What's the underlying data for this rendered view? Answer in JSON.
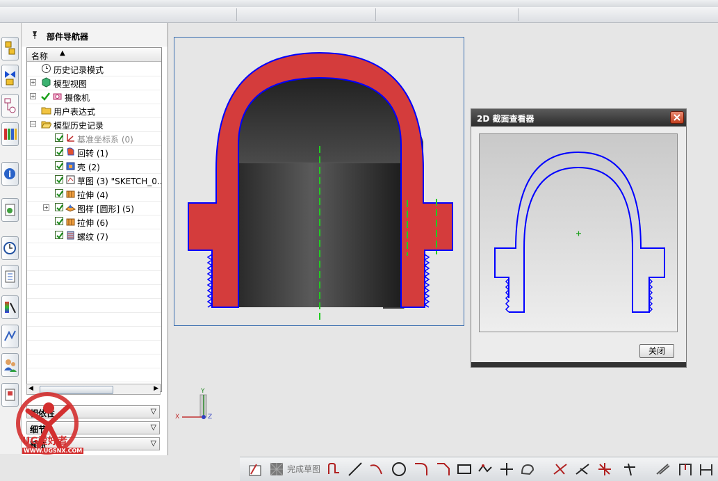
{
  "navigator": {
    "title": "部件导航器",
    "column_header": "名称",
    "sort_indicator": "▲",
    "items": [
      {
        "label": "历史记录模式",
        "icon": "clock-icon",
        "indent": 0,
        "expander": false,
        "checkbox": false
      },
      {
        "label": "模型视图",
        "icon": "model-view-icon",
        "indent": 0,
        "expander": true,
        "checkbox": false
      },
      {
        "label": "摄像机",
        "icon": "camera-icon",
        "indent": 0,
        "expander": true,
        "checkbox": false
      },
      {
        "label": "用户表达式",
        "icon": "folder-icon",
        "indent": 0,
        "expander": false,
        "checkbox": false
      },
      {
        "label": "模型历史记录",
        "icon": "folder-open-icon",
        "indent": 0,
        "expander": true,
        "checkbox": false
      },
      {
        "label": "基准坐标系 (0)",
        "icon": "datum-csys-icon",
        "indent": 1,
        "expander": false,
        "checkbox": true,
        "dim": true
      },
      {
        "label": "回转 (1)",
        "icon": "revolve-icon",
        "indent": 1,
        "expander": false,
        "checkbox": true
      },
      {
        "label": "壳 (2)",
        "icon": "shell-icon",
        "indent": 1,
        "expander": false,
        "checkbox": true
      },
      {
        "label": "草图 (3) \"SKETCH_0...",
        "icon": "sketch-icon",
        "indent": 1,
        "expander": false,
        "checkbox": true
      },
      {
        "label": "拉伸 (4)",
        "icon": "extrude-icon",
        "indent": 1,
        "expander": false,
        "checkbox": true
      },
      {
        "label": "图样 [圆形] (5)",
        "icon": "pattern-icon",
        "indent": 1,
        "expander": true,
        "checkbox": true
      },
      {
        "label": "拉伸 (6)",
        "icon": "extrude-icon",
        "indent": 1,
        "expander": false,
        "checkbox": true
      },
      {
        "label": "螺纹 (7)",
        "icon": "thread-icon",
        "indent": 1,
        "expander": false,
        "checkbox": true
      }
    ],
    "panels": [
      {
        "label": "相依性"
      },
      {
        "label": "细节"
      },
      {
        "label": "预览"
      }
    ]
  },
  "dialog": {
    "title": "2D 截面查看器",
    "close_button": "关闭"
  },
  "bottom_toolbar": {
    "finish_sketch": "完成草图"
  },
  "triad": {
    "x": "X",
    "y": "Y",
    "z": "Z"
  },
  "watermark": {
    "brand": "UG爱好者",
    "url": "WWW.UGSNX.COM"
  },
  "colors": {
    "section_fill": "#d43c3c",
    "section_outline": "#0000ff",
    "centerline": "#22cc22",
    "view_border": "#3b6fb0"
  },
  "icons": {
    "resource_bar": [
      "assembly-navigator-icon",
      "constraint-navigator-icon",
      "part-navigator-icon",
      "reuse-library-icon",
      "web-browser-icon",
      "history-icon",
      "system-materials-icon",
      "process-studio-icon",
      "manufacturing-wizard-icon",
      "roles-icon",
      "system-scenes-icon"
    ]
  }
}
